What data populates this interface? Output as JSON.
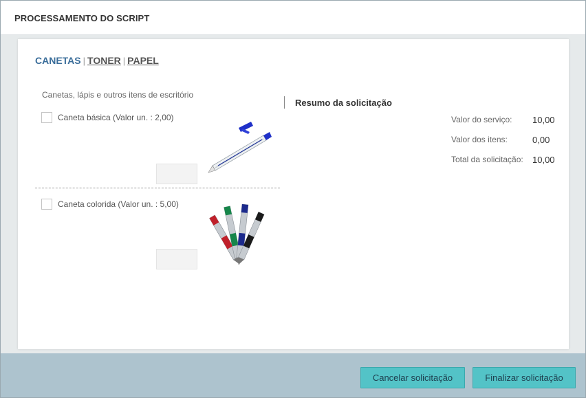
{
  "header": {
    "title": "PROCESSAMENTO DO SCRIPT"
  },
  "tabs": [
    {
      "label": "CANETAS",
      "active": true
    },
    {
      "label": "TONER",
      "active": false
    },
    {
      "label": "PAPEL",
      "active": false
    }
  ],
  "tab_separator": "|",
  "section": {
    "description": "Canetas, lápis e outros itens de escritório",
    "items": [
      {
        "label": "Caneta básica (Valor un. : 2,00)",
        "checked": false,
        "quantity": ""
      },
      {
        "label": "Caneta colorida (Valor un. : 5,00)",
        "checked": false,
        "quantity": ""
      }
    ]
  },
  "summary": {
    "title": "Resumo da solicitação",
    "rows": [
      {
        "label": "Valor do serviço:",
        "value": "10,00"
      },
      {
        "label": "Valor dos itens:",
        "value": "0,00"
      },
      {
        "label": "Total da solicitação:",
        "value": "10,00"
      }
    ]
  },
  "footer": {
    "cancel_label": "Cancelar solicitação",
    "finish_label": "Finalizar solicitação"
  },
  "colors": {
    "accent": "#53c3c7",
    "active_tab": "#3a6d9a",
    "footer_bg": "#adc3ce"
  }
}
